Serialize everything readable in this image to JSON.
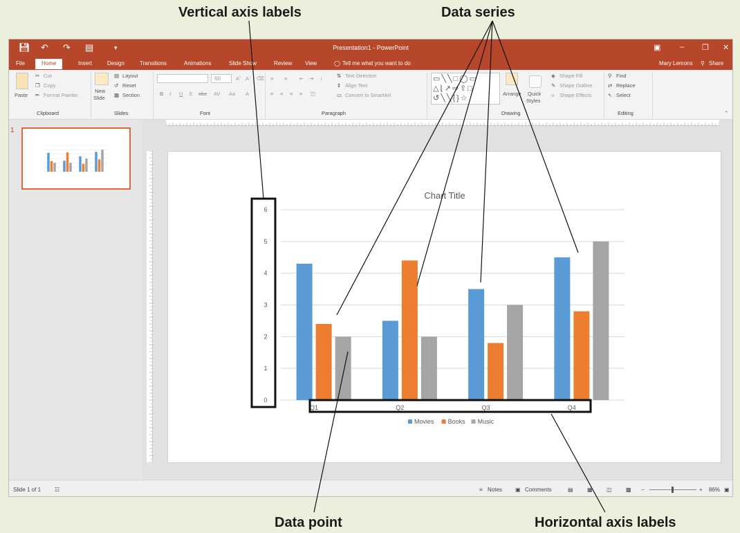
{
  "callouts": {
    "vertical_axis_labels": "Vertical axis labels",
    "data_series": "Data series",
    "data_point": "Data point",
    "horizontal_axis_labels": "Horizontal axis labels"
  },
  "window": {
    "title": "Presentation1 - PowerPoint",
    "user": "Mary Lemons",
    "share": "Share"
  },
  "tabs": [
    "File",
    "Home",
    "Insert",
    "Design",
    "Transitions",
    "Animations",
    "Slide Show",
    "Review",
    "View"
  ],
  "tell_me": "Tell me what you want to do",
  "ribbon": {
    "clipboard": {
      "paste": "Paste",
      "cut": "Cut",
      "copy": "Copy",
      "format_painter": "Format Painter",
      "label": "Clipboard"
    },
    "slides": {
      "new_slide": "New",
      "new_slide2": "Slide",
      "layout": "Layout",
      "reset": "Reset",
      "section": "Section",
      "label": "Slides"
    },
    "font": {
      "size": "60",
      "label": "Font"
    },
    "paragraph": {
      "text_direction": "Text Direction",
      "align_text": "Align Text",
      "convert_smartart": "Convert to SmartArt",
      "label": "Paragraph"
    },
    "drawing": {
      "arrange": "Arrange",
      "quick_styles": "Quick",
      "quick_styles2": "Styles",
      "shape_fill": "Shape Fill",
      "shape_outline": "Shape Outline",
      "shape_effects": "Shape Effects",
      "label": "Drawing"
    },
    "editing": {
      "find": "Find",
      "replace": "Replace",
      "select": "Select",
      "label": "Editing"
    }
  },
  "thumbnail": {
    "number": "1"
  },
  "status": {
    "slide_info": "Slide 1 of 1",
    "notes": "Notes",
    "comments": "Comments",
    "zoom": "86%"
  },
  "colors": {
    "accent": "#b7472a",
    "movies": "#5b9bd5",
    "books": "#ed7d31",
    "music": "#a5a5a5"
  },
  "chart_data": {
    "type": "bar",
    "title": "Chart Title",
    "categories": [
      "Q1",
      "Q2",
      "Q3",
      "Q4"
    ],
    "series": [
      {
        "name": "Movies",
        "values": [
          4.3,
          2.5,
          3.5,
          4.5
        ]
      },
      {
        "name": "Books",
        "values": [
          2.4,
          4.4,
          1.8,
          2.8
        ]
      },
      {
        "name": "Music",
        "values": [
          2,
          2,
          3,
          5
        ]
      }
    ],
    "ylim": [
      0,
      6
    ],
    "yticks": [
      "0",
      "1",
      "2",
      "3",
      "4",
      "5",
      "6"
    ],
    "grid": true,
    "legend": "bottom"
  }
}
